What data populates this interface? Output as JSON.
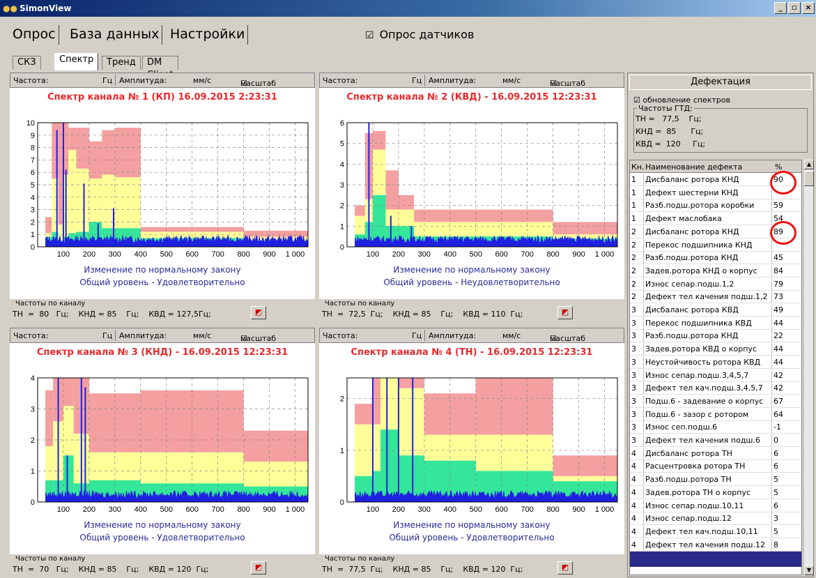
{
  "window": {
    "title": "SimonView",
    "min": "_",
    "max": "▫",
    "close": "×"
  },
  "menu": {
    "tabs": [
      "Опрос",
      "База данных",
      "Настройки"
    ],
    "poll_check": "☑",
    "poll_label": "Опрос датчиков"
  },
  "subtabs": [
    "СКЗ",
    "Спектр",
    "Тренд",
    "DM Client"
  ],
  "panel_header": {
    "freq_label": "Частота:",
    "freq_unit": "Гц",
    "amp_label": "Амплитуда:",
    "amp_unit": "мм/с",
    "scale_check": "☑",
    "scale_label": "масштаб"
  },
  "footer_legend": "Частоты по каналу",
  "charts": [
    {
      "title": "Спектр канала № 1 (КП) 16.09.2015 2:23:31",
      "note1": "Изменение по нормальному закону",
      "note2": "Общий уровень - Удовлетворительно",
      "footer": "ТН  =  80   Гц;    КНД = 85    Гц;    КВД = 127,5Гц;"
    },
    {
      "title": "Спектр канала № 2 (КВД) - 16.09.2015 12:23:31",
      "note1": "Изменение по нормальному закону",
      "note2": "Общий уровень - Неудовлетворительно",
      "footer": "ТН  =  72,5  Гц;    КНД = 85    Гц;    КВД = 110  Гц;"
    },
    {
      "title": "Спектр канала № 3 (КНД) - 16.09.2015  12:23:31",
      "note1": "Изменение по нормальному закону",
      "note2": "Общий уровень - Удовлетворительно",
      "footer": "ТН  =  70   Гц;    КНД = 85    Гц;    КВД = 120  Гц;"
    },
    {
      "title": "Спектр канала № 4 (ТН) - 16.09.2015  12:23:31",
      "note1": "Изменение по нормальному закону",
      "note2": "Общий уровень - Удовлетворительно",
      "footer": "ТН  =  77,5  Гц;    КНД = 85    Гц;    КВД = 120  Гц;"
    }
  ],
  "chart_data": [
    {
      "type": "area",
      "x_ticks": [
        "100",
        "200",
        "300",
        "400",
        "500",
        "600",
        "700",
        "800",
        "900",
        "1 000"
      ],
      "y_ticks": [
        "0",
        "1",
        "2",
        "3",
        "4",
        "5",
        "6",
        "7",
        "8",
        "9",
        "10"
      ],
      "ylim": [
        0,
        10
      ],
      "xlim": [
        0,
        1050
      ],
      "bands": [
        [
          30,
          55,
          0.8,
          1.1,
          2.4
        ],
        [
          55,
          80,
          1.2,
          5.5,
          10
        ],
        [
          80,
          100,
          0.5,
          1.8,
          10
        ],
        [
          100,
          120,
          0.8,
          5.8,
          10
        ],
        [
          120,
          150,
          1.1,
          7.8,
          9.6
        ],
        [
          150,
          200,
          1.2,
          6.3,
          9.6
        ],
        [
          200,
          250,
          2,
          5.5,
          8.5
        ],
        [
          250,
          300,
          1.5,
          5.8,
          9.4
        ],
        [
          300,
          400,
          1.5,
          5.6,
          9.6
        ],
        [
          400,
          800,
          0.7,
          1.2,
          1.6
        ],
        [
          800,
          1050,
          0.5,
          0.8,
          1.3
        ]
      ],
      "peaks": [
        [
          75,
          9.4
        ],
        [
          100,
          10
        ],
        [
          110,
          6.2
        ],
        [
          180,
          5.1
        ],
        [
          235,
          1.9
        ],
        [
          295,
          3.1
        ]
      ]
    },
    {
      "type": "area",
      "x_ticks": [
        "100",
        "200",
        "300",
        "400",
        "500",
        "600",
        "700",
        "800",
        "900",
        "1 000"
      ],
      "y_ticks": [
        "0",
        "1",
        "2",
        "3",
        "4",
        "5",
        "6"
      ],
      "ylim": [
        0,
        6
      ],
      "xlim": [
        0,
        1050
      ],
      "bands": [
        [
          30,
          70,
          0.6,
          1.5,
          2
        ],
        [
          70,
          100,
          1.2,
          2.3,
          5.5
        ],
        [
          100,
          150,
          2.5,
          4.7,
          5.6
        ],
        [
          150,
          200,
          1,
          1.8,
          3.7
        ],
        [
          200,
          260,
          1,
          1.8,
          2.5
        ],
        [
          260,
          800,
          0.5,
          1.2,
          1.8
        ],
        [
          800,
          1050,
          0.4,
          0.6,
          1.2
        ]
      ],
      "peaks": [
        [
          85,
          6
        ],
        [
          170,
          1.5
        ],
        [
          250,
          1
        ]
      ]
    },
    {
      "type": "area",
      "x_ticks": [
        "100",
        "200",
        "300",
        "400",
        "500",
        "600",
        "700",
        "800",
        "900",
        "1 000"
      ],
      "y_ticks": [
        "0",
        "1",
        "2",
        "3",
        "4"
      ],
      "ylim": [
        0,
        4
      ],
      "xlim": [
        0,
        1050
      ],
      "bands": [
        [
          30,
          60,
          0.7,
          1.8,
          3.6
        ],
        [
          60,
          100,
          0.7,
          2.6,
          4
        ],
        [
          100,
          140,
          1.5,
          3.1,
          4
        ],
        [
          140,
          200,
          0.6,
          2.2,
          4
        ],
        [
          200,
          400,
          0.7,
          1.6,
          3.5
        ],
        [
          400,
          800,
          0.6,
          1.6,
          3.6
        ],
        [
          800,
          1050,
          0.5,
          1.3,
          2.3
        ]
      ],
      "peaks": [
        [
          80,
          4
        ],
        [
          115,
          1.5
        ],
        [
          170,
          4
        ],
        [
          185,
          3.7
        ]
      ]
    },
    {
      "type": "area",
      "x_ticks": [
        "100",
        "200",
        "300",
        "400",
        "500",
        "600",
        "700",
        "800",
        "900",
        "1 000"
      ],
      "y_ticks": [
        "0",
        "1",
        "2"
      ],
      "ylim": [
        0,
        2.4
      ],
      "xlim": [
        0,
        1050
      ],
      "bands": [
        [
          30,
          100,
          0.5,
          1.5,
          1.9
        ],
        [
          100,
          130,
          0.6,
          1.5,
          2.4
        ],
        [
          130,
          200,
          1.4,
          2.4,
          2.4
        ],
        [
          200,
          300,
          0.9,
          2.2,
          2.4
        ],
        [
          300,
          500,
          0.8,
          1.3,
          2.1
        ],
        [
          500,
          800,
          0.6,
          1.3,
          2.4
        ],
        [
          800,
          1050,
          0.4,
          0.5,
          0.9
        ]
      ],
      "peaks": [
        [
          100,
          2.4
        ],
        [
          155,
          2.4
        ],
        [
          200,
          2.4
        ],
        [
          255,
          2.4
        ]
      ]
    }
  ],
  "defect": {
    "title": "Дефектация",
    "spectra_check": "☑",
    "spectra_label": "обновление спектров",
    "gtd_legend": "Частоты ГТД:",
    "gtd": [
      "ТН =   77,5    Гц;",
      "КНД =  85      Гц;",
      "КВД =  120     Гц;"
    ],
    "col_kn": "Кн.",
    "col_name": "Наименование дефекта",
    "col_pct": "%",
    "rows": [
      [
        "1",
        "Дисбаланс ротора КНД",
        "90"
      ],
      [
        "1",
        "Дефект шестерни КНД",
        ""
      ],
      [
        "1",
        "Разб.подш.ротора коробки",
        "59"
      ],
      [
        "1",
        "Дефект маслобака",
        "54"
      ],
      [
        "2",
        "Дисбаланс ротора КНД",
        "89"
      ],
      [
        "2",
        "Перекос подшипника КНД",
        ""
      ],
      [
        "2",
        "Разб.подш.ротора КНД",
        "45"
      ],
      [
        "2",
        "Задев.ротора КНД о корпус",
        "84"
      ],
      [
        "2",
        "Износ сепар.подш.1,2",
        "79"
      ],
      [
        "2",
        "Дефект тел качения подш.1,2",
        "73"
      ],
      [
        "3",
        "Дисбаланс ротора КВД",
        "49"
      ],
      [
        "3",
        "Перекос подшипника КВД",
        "44"
      ],
      [
        "3",
        "Разб.подш.ротора КНД",
        "22"
      ],
      [
        "3",
        "Задев.ротора КВД о корпус",
        "44"
      ],
      [
        "3",
        "Неустойчивость ротора КВД",
        "44"
      ],
      [
        "3",
        "Износ сепар.подш.3,4,5,7",
        "42"
      ],
      [
        "3",
        "Дефект тел кач.подш.3,4,5,7",
        "42"
      ],
      [
        "3",
        "Подш.6 - задевание о корпус",
        "67"
      ],
      [
        "3",
        "Подш.6 - зазор с ротором",
        "64"
      ],
      [
        "3",
        "Износ сеп.подш.6",
        "-1"
      ],
      [
        "3",
        "Дефект тел качения подш.6",
        "0"
      ],
      [
        "4",
        "Дисбаланс ротора ТН",
        "6"
      ],
      [
        "4",
        "Расцентровка ротора ТН",
        "6"
      ],
      [
        "4",
        "Разб.подш.ротора ТН",
        "5"
      ],
      [
        "4",
        "Задев.ротора ТН о корпус",
        "5"
      ],
      [
        "4",
        "Износ сепар.подш.10,11",
        "6"
      ],
      [
        "4",
        "Износ сепар.подш.12",
        "3"
      ],
      [
        "4",
        "Дефект тел кач.подш.10,11",
        "5"
      ],
      [
        "4",
        "Дефект тел качения подш.12",
        "8"
      ]
    ]
  },
  "colors": {
    "red_zone": "#f4a0a0",
    "yellow_zone": "#ffff99",
    "green_zone": "#33e699",
    "spectrum": "#2020e0",
    "title": "#e8282c",
    "note": "#2a2a9a",
    "circle": "#ee1010"
  },
  "icons": {
    "app": "simonview-icon",
    "fft": "spectrum-icon",
    "scroll_up": "▲",
    "scroll_down": "▼"
  }
}
